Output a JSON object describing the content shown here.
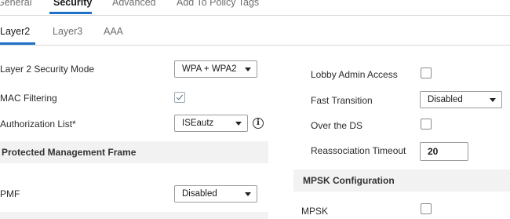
{
  "tabs_top": [
    {
      "label": "General",
      "active": false
    },
    {
      "label": "Security",
      "active": true
    },
    {
      "label": "Advanced",
      "active": false
    },
    {
      "label": "Add To Policy Tags",
      "active": false
    }
  ],
  "tabs_sub": [
    {
      "label": "Layer2",
      "active": true
    },
    {
      "label": "Layer3",
      "active": false
    },
    {
      "label": "AAA",
      "active": false
    }
  ],
  "left": {
    "security_mode": {
      "label": "Layer 2 Security Mode",
      "value": "WPA + WPA2"
    },
    "mac_filtering": {
      "label": "MAC Filtering",
      "checked": true
    },
    "authorization_list": {
      "label": "Authorization List*",
      "value": "ISEautz",
      "info_icon": "info-icon"
    },
    "pmf_section_title": "Protected Management Frame",
    "pmf": {
      "label": "PMF",
      "value": "Disabled"
    }
  },
  "right": {
    "lobby_admin": {
      "label": "Lobby Admin Access",
      "checked": false
    },
    "fast_transition": {
      "label": "Fast Transition",
      "value": "Disabled"
    },
    "over_the_ds": {
      "label": "Over the DS",
      "checked": false
    },
    "reassociation_timeout": {
      "label": "Reassociation Timeout",
      "value": "20"
    },
    "mpsk_section_title": "MPSK Configuration",
    "mpsk": {
      "label": "MPSK",
      "checked": false
    }
  },
  "colors": {
    "accent": "#1c72c7",
    "section_bg": "#f2f2f2"
  }
}
